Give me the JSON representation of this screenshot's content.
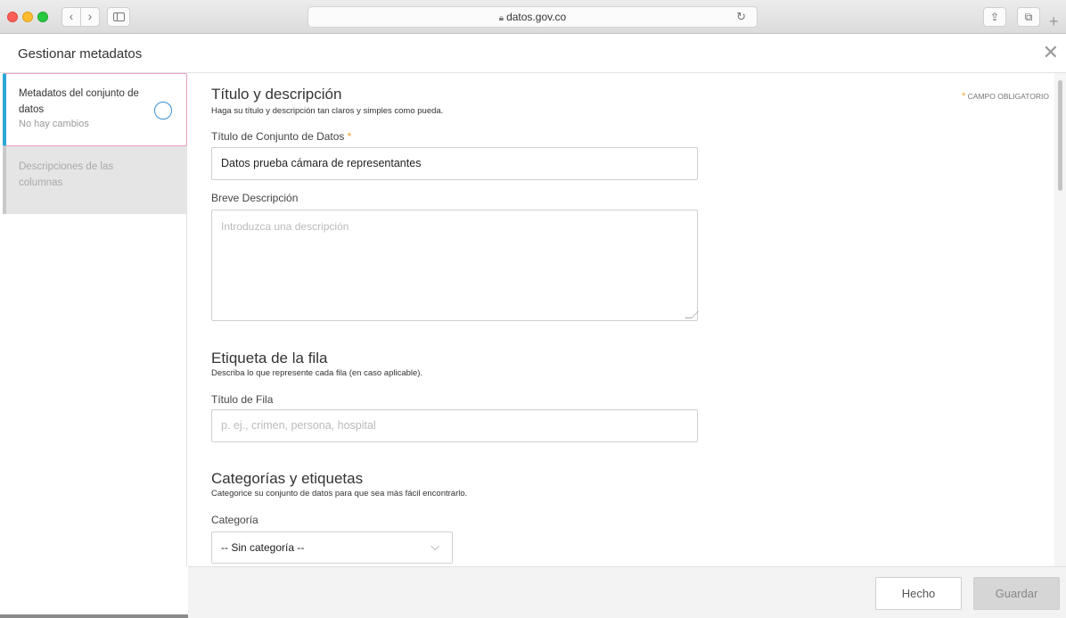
{
  "browser": {
    "url": "datos.gov.co",
    "lock_icon": "lock-icon",
    "reload_icon": "reload-icon"
  },
  "modal": {
    "title": "Gestionar metadatos",
    "close_icon": "close-icon"
  },
  "sidebar": {
    "items": [
      {
        "label": "Metadatos del conjunto de datos",
        "sub": "No hay cambios",
        "active": true
      },
      {
        "label": "Descripciones de las columnas",
        "active": false
      }
    ]
  },
  "main": {
    "required_note": "CAMPO OBLIGATORIO",
    "title_section": {
      "title": "Título y descripción",
      "desc": "Haga su título y descripción tan claros y simples como pueda.",
      "dataset_title_label": "Título de Conjunto de Datos",
      "dataset_title_value": "Datos prueba cámara de representantes",
      "short_desc_label": "Breve Descripción",
      "short_desc_placeholder": "Introduzca una descripción"
    },
    "row_section": {
      "title": "Etiqueta de la fila",
      "desc": "Describa lo que represente cada fila (en caso aplicable).",
      "row_title_label": "Título de Fila",
      "row_title_placeholder": "p. ej., crimen, persona, hospital"
    },
    "category_section": {
      "title": "Categorías y etiquetas",
      "desc": "Categorice su conjunto de datos para que sea más fácil encontrarlo.",
      "category_label": "Categoría",
      "category_value": "-- Sin categoría --"
    }
  },
  "footer": {
    "done_label": "Hecho",
    "save_label": "Guardar"
  },
  "colors": {
    "active_accent": "#2ca6d6",
    "active_border": "#e8a0c4",
    "required_star": "#f0a030"
  }
}
